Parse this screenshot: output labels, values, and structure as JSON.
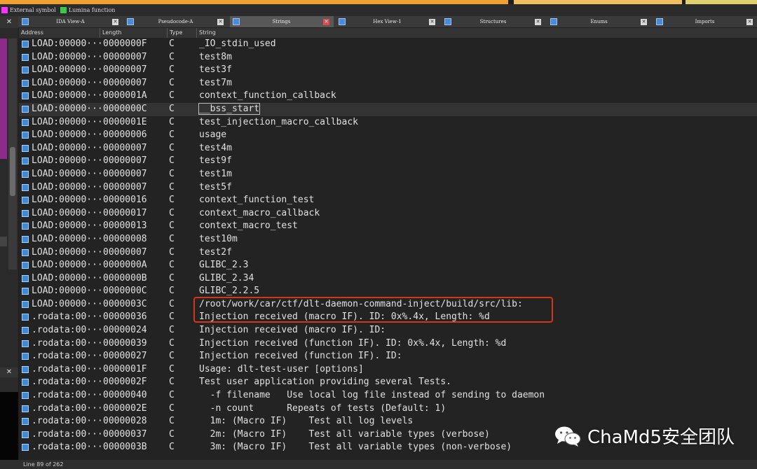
{
  "legend": {
    "items": [
      {
        "label": "External symbol",
        "color": "#ff33ff"
      },
      {
        "label": "Lumina function",
        "color": "#3cc84a"
      }
    ]
  },
  "tabs": [
    {
      "label": "IDA View-A",
      "icon": "ida-view-icon",
      "active": false
    },
    {
      "label": "Pseudocode-A",
      "icon": "pseudocode-icon",
      "active": false
    },
    {
      "label": "Strings",
      "icon": "strings-icon",
      "active": true
    },
    {
      "label": "Hex View-1",
      "icon": "hex-view-icon",
      "active": false
    },
    {
      "label": "Structures",
      "icon": "structures-icon",
      "active": false
    },
    {
      "label": "Enums",
      "icon": "enums-icon",
      "active": false
    },
    {
      "label": "Imports",
      "icon": "imports-icon",
      "active": false
    }
  ],
  "close_glyph": "✕",
  "columns": [
    "Address",
    "Length",
    "Type",
    "String"
  ],
  "rows": [
    {
      "addr": "LOAD:00000···",
      "len": "0000000F",
      "type": "C",
      "str": "_IO_stdin_used"
    },
    {
      "addr": "LOAD:00000···",
      "len": "00000007",
      "type": "C",
      "str": "test8m"
    },
    {
      "addr": "LOAD:00000···",
      "len": "00000007",
      "type": "C",
      "str": "test3f"
    },
    {
      "addr": "LOAD:00000···",
      "len": "00000007",
      "type": "C",
      "str": "test7m"
    },
    {
      "addr": "LOAD:00000···",
      "len": "0000001A",
      "type": "C",
      "str": "context_function_callback"
    },
    {
      "addr": "LOAD:00000···",
      "len": "0000000C",
      "type": "C",
      "str": "__bss_start",
      "selected": true
    },
    {
      "addr": "LOAD:00000···",
      "len": "0000001E",
      "type": "C",
      "str": "test_injection_macro_callback"
    },
    {
      "addr": "LOAD:00000···",
      "len": "00000006",
      "type": "C",
      "str": "usage"
    },
    {
      "addr": "LOAD:00000···",
      "len": "00000007",
      "type": "C",
      "str": "test4m"
    },
    {
      "addr": "LOAD:00000···",
      "len": "00000007",
      "type": "C",
      "str": "test9f"
    },
    {
      "addr": "LOAD:00000···",
      "len": "00000007",
      "type": "C",
      "str": "test1m"
    },
    {
      "addr": "LOAD:00000···",
      "len": "00000007",
      "type": "C",
      "str": "test5f"
    },
    {
      "addr": "LOAD:00000···",
      "len": "00000016",
      "type": "C",
      "str": "context_function_test"
    },
    {
      "addr": "LOAD:00000···",
      "len": "00000017",
      "type": "C",
      "str": "context_macro_callback"
    },
    {
      "addr": "LOAD:00000···",
      "len": "00000013",
      "type": "C",
      "str": "context_macro_test"
    },
    {
      "addr": "LOAD:00000···",
      "len": "00000008",
      "type": "C",
      "str": "test10m"
    },
    {
      "addr": "LOAD:00000···",
      "len": "00000007",
      "type": "C",
      "str": "test2f"
    },
    {
      "addr": "LOAD:00000···",
      "len": "0000000A",
      "type": "C",
      "str": "GLIBC_2.3"
    },
    {
      "addr": "LOAD:00000···",
      "len": "0000000B",
      "type": "C",
      "str": "GLIBC_2.34"
    },
    {
      "addr": "LOAD:00000···",
      "len": "0000000C",
      "type": "C",
      "str": "GLIBC_2.2.5"
    },
    {
      "addr": "LOAD:00000···",
      "len": "0000003C",
      "type": "C",
      "str": "/root/work/car/ctf/dlt-daemon-command-inject/build/src/lib:"
    },
    {
      "addr": ".rodata:00···",
      "len": "00000036",
      "type": "C",
      "str": "Injection received (macro IF). ID: 0x%.4x, Length: %d"
    },
    {
      "addr": ".rodata:00···",
      "len": "00000024",
      "type": "C",
      "str": "Injection received (macro IF). ID:"
    },
    {
      "addr": ".rodata:00···",
      "len": "00000039",
      "type": "C",
      "str": "Injection received (function IF). ID: 0x%.4x, Length: %d"
    },
    {
      "addr": ".rodata:00···",
      "len": "00000027",
      "type": "C",
      "str": "Injection received (function IF). ID:"
    },
    {
      "addr": ".rodata:00···",
      "len": "0000001F",
      "type": "C",
      "str": "Usage: dlt-test-user [options]"
    },
    {
      "addr": ".rodata:00···",
      "len": "0000002F",
      "type": "C",
      "str": "Test user application providing several Tests."
    },
    {
      "addr": ".rodata:00···",
      "len": "00000040",
      "type": "C",
      "str": "  -f filename   Use local log file instead of sending to daemon"
    },
    {
      "addr": ".rodata:00···",
      "len": "0000002E",
      "type": "C",
      "str": "  -n count      Repeats of tests (Default: 1)"
    },
    {
      "addr": ".rodata:00···",
      "len": "00000028",
      "type": "C",
      "str": "  1m: (Macro IF)    Test all log levels"
    },
    {
      "addr": ".rodata:00···",
      "len": "00000037",
      "type": "C",
      "str": "  2m: (Macro IF)    Test all variable types (verbose)"
    },
    {
      "addr": ".rodata:00···",
      "len": "0000003B",
      "type": "C",
      "str": "  3m: (Macro IF)    Test all variable types (non-verbose)"
    }
  ],
  "watermark": {
    "text": "ChaMd5安全团队",
    "icon": "wechat-icon"
  },
  "status": {
    "text": "Line 89 of 262"
  },
  "colors": {
    "highlight_box": "#d2361b",
    "active_tab": "#585858",
    "row_icon": "#3e8ad6"
  }
}
